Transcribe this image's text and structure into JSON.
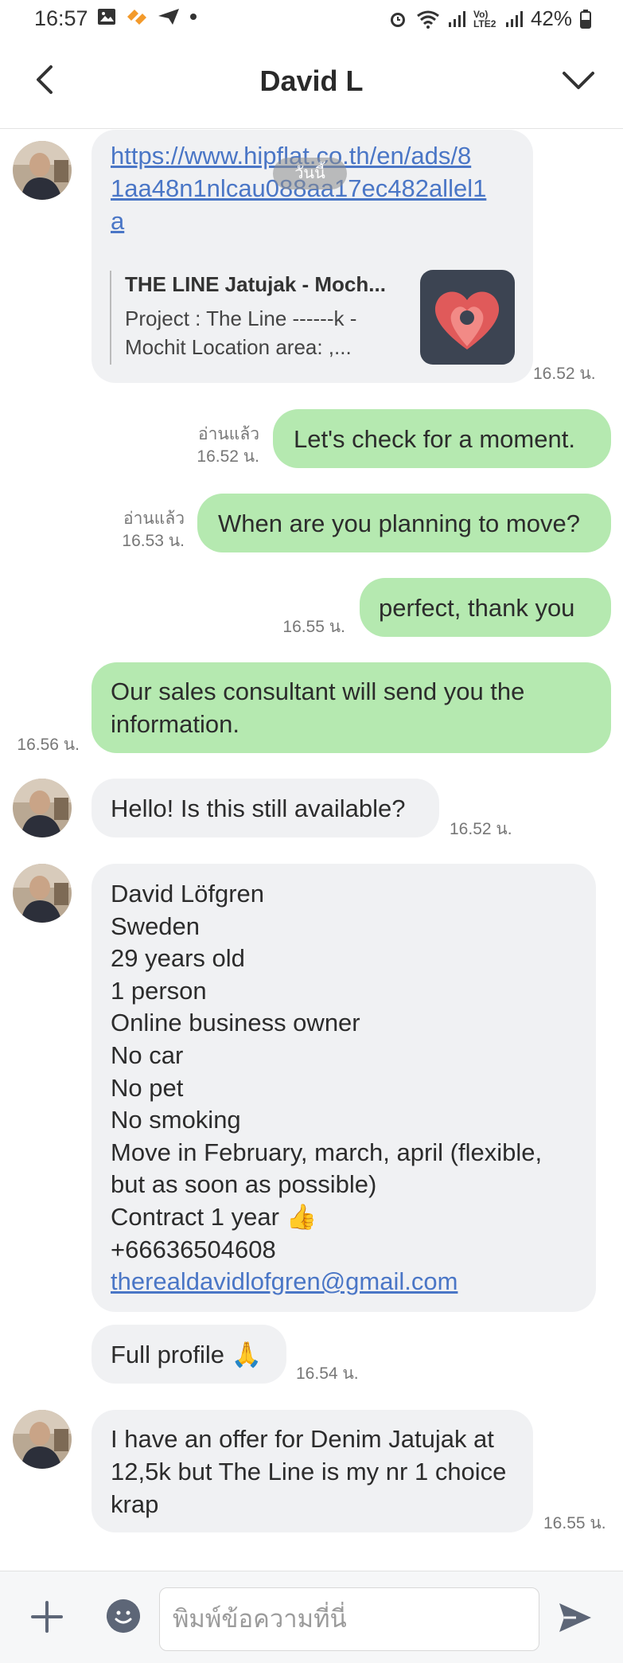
{
  "status_bar": {
    "time": "16:57",
    "network": "Vo) LTE2",
    "battery": "42%",
    "icons": [
      "gallery-icon",
      "app-icon",
      "send-icon",
      "dot-icon",
      "alarm-icon",
      "wifi-icon",
      "signal-icon",
      "signal-icon",
      "battery-icon"
    ]
  },
  "header": {
    "title": "David L",
    "back_icon": "chevron-left-icon",
    "collapse_icon": "chevron-down-icon"
  },
  "messages": {
    "m1": {
      "link": "https://www.hipflat.co.th/en/ads/81aa48n1nlcau088aa17ec482allel1a",
      "link_lines": [
        "https://www.hipflat.co.th/en/ads/8",
        "1aa48n1nlcau088aa17ec482allel1",
        "a"
      ],
      "preview_title": "THE LINE Jatujak - Moch...",
      "preview_desc": "Project : The Line ------k - Mochit Location area: ,...",
      "overlay": "วันนี้",
      "time": "16.52 น."
    },
    "m2": {
      "text": "Let's check for a moment.",
      "read": "อ่านแล้ว",
      "time": "16.52 น."
    },
    "m3": {
      "text": "When are you planning to move?",
      "read": "อ่านแล้ว",
      "time": "16.53 น."
    },
    "m4": {
      "text": "perfect, thank you",
      "time": "16.55 น."
    },
    "m5": {
      "text": "Our sales consultant will send you the information.",
      "time": "16.56 น."
    },
    "m6": {
      "text": "Hello! Is this still available?",
      "time": "16.52 น."
    },
    "m7": {
      "lines": [
        "David Löfgren",
        "Sweden",
        "29 years old",
        "1 person",
        "Online business owner",
        "No car",
        "No pet",
        "No smoking",
        "Move in February, march, april (flexible, but as soon as possible)",
        "Contract 1 year 👍",
        "+66636504608"
      ],
      "email": "therealdavidlofgren@gmail.com"
    },
    "m8": {
      "text": "Full profile 🙏",
      "time": "16.54 น."
    },
    "m9": {
      "text": "I have an offer for Denim Jatujak at 12,5k but The Line is my nr 1 choice krap",
      "time": "16.55 น."
    }
  },
  "input_bar": {
    "placeholder": "พิมพ์ข้อความที่นี่",
    "plus_icon": "plus-icon",
    "emoji_icon": "emoji-icon",
    "send_icon": "send-icon"
  },
  "colors": {
    "outgoing_bubble": "#b5e9b0",
    "incoming_bubble": "#f0f1f3",
    "link": "#4a76c6"
  }
}
